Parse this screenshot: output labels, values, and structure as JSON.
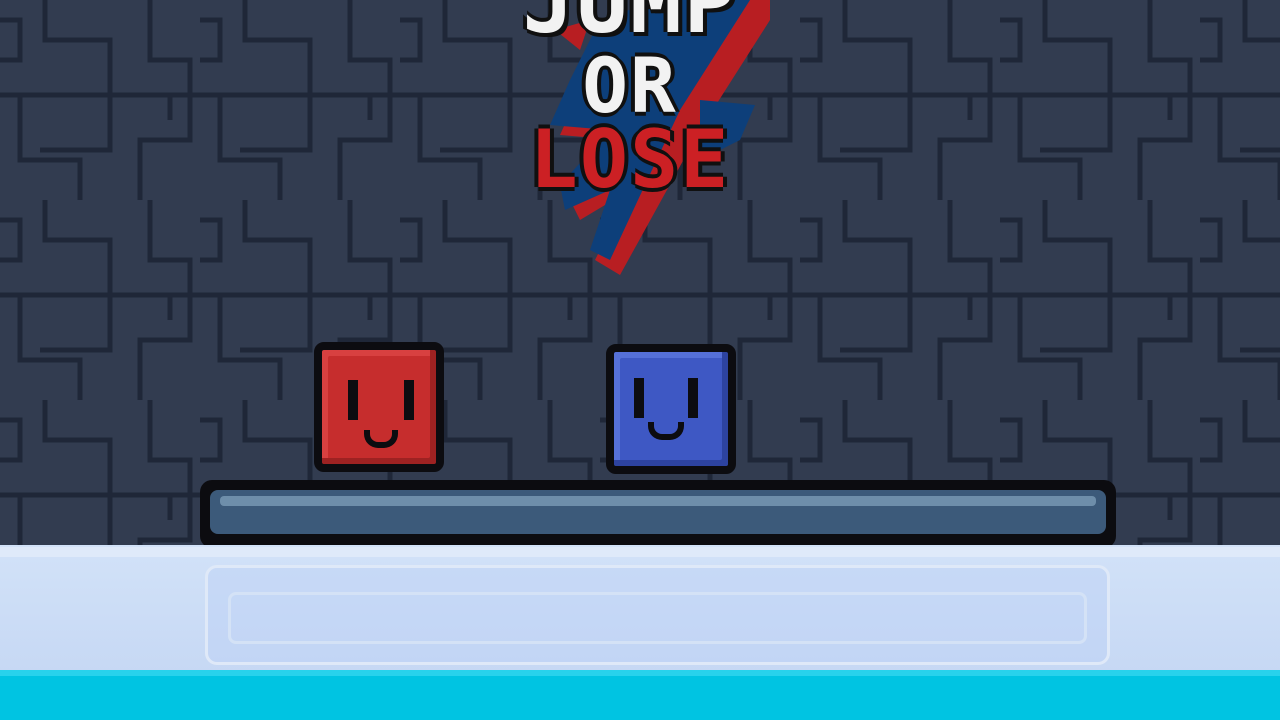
{
  "game": {
    "title_lines": [
      "JUMP",
      "OR",
      "LOSE"
    ],
    "colors": {
      "background": "#323c50",
      "pattern_line": "#1f2738",
      "red_player": "#c62d2d",
      "blue_player": "#3e58c4",
      "platform": "#3c5a7a",
      "ice": "#d2e2f8",
      "water": "#00c4e2"
    }
  },
  "players": [
    {
      "name": "red-player",
      "color": "#c62d2d"
    },
    {
      "name": "blue-player",
      "color": "#3e58c4"
    }
  ]
}
